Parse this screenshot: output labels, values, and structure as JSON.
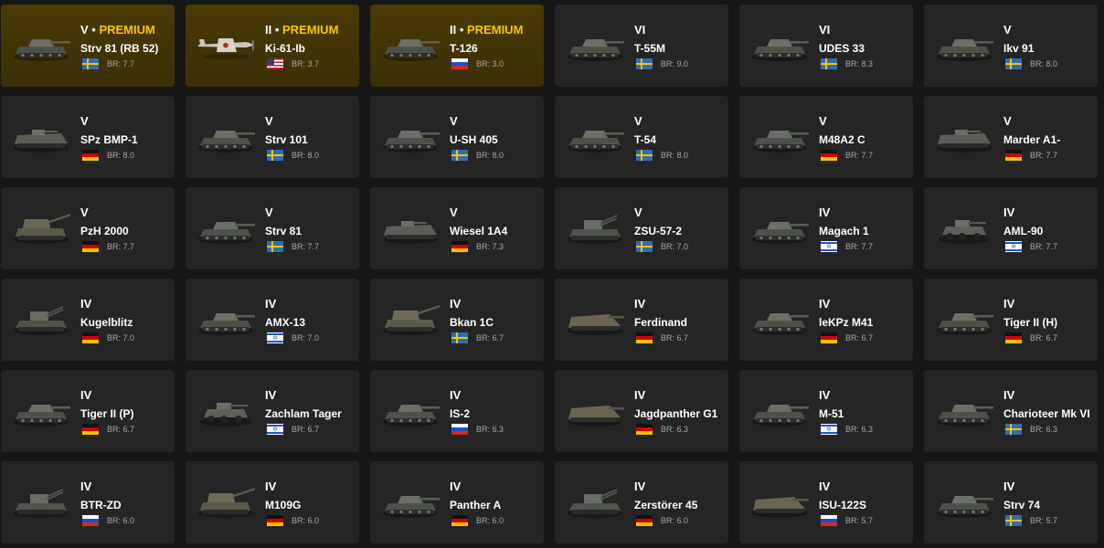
{
  "colors": {
    "background": "#161616",
    "card": "#252525",
    "premium_card": "#3b2f06",
    "premium_text": "#ffc400",
    "br_text": "#a9a9a9"
  },
  "vehicles": [
    {
      "rank": "V",
      "premium": "PREMIUM",
      "name": "Strv 81 (RB 52)",
      "flag": "sweden",
      "br": "BR: 7.7",
      "icon": "tank-icon"
    },
    {
      "rank": "II",
      "premium": "PREMIUM",
      "name": "Ki-61-Ib",
      "flag": "usa",
      "br": "BR: 3.7",
      "icon": "fighter-plane-icon"
    },
    {
      "rank": "II",
      "premium": "PREMIUM",
      "name": "T-126",
      "flag": "russia",
      "br": "BR: 3.0",
      "icon": "tank-icon"
    },
    {
      "rank": "VI",
      "premium": "",
      "name": "T-55M",
      "flag": "sweden",
      "br": "BR: 9.0",
      "icon": "tank-icon"
    },
    {
      "rank": "VI",
      "premium": "",
      "name": "UDES 33",
      "flag": "sweden",
      "br": "BR: 8.3",
      "icon": "tank-icon"
    },
    {
      "rank": "V",
      "premium": "",
      "name": "Ikv 91",
      "flag": "sweden",
      "br": "BR: 8.0",
      "icon": "tank-icon"
    },
    {
      "rank": "V",
      "premium": "",
      "name": "SPz BMP-1",
      "flag": "germany",
      "br": "BR: 8.0",
      "icon": "ifv-icon"
    },
    {
      "rank": "V",
      "premium": "",
      "name": "Strv 101",
      "flag": "sweden",
      "br": "BR: 8.0",
      "icon": "tank-icon"
    },
    {
      "rank": "V",
      "premium": "",
      "name": "U-SH 405",
      "flag": "sweden",
      "br": "BR: 8.0",
      "icon": "tank-icon"
    },
    {
      "rank": "V",
      "premium": "",
      "name": "T-54",
      "flag": "sweden",
      "br": "BR: 8.0",
      "icon": "tank-icon"
    },
    {
      "rank": "V",
      "premium": "",
      "name": "M48A2 C",
      "flag": "germany",
      "br": "BR: 7.7",
      "icon": "tank-icon"
    },
    {
      "rank": "V",
      "premium": "",
      "name": "Marder A1-",
      "flag": "germany",
      "br": "BR: 7.7",
      "icon": "ifv-icon"
    },
    {
      "rank": "V",
      "premium": "",
      "name": "PzH 2000",
      "flag": "germany",
      "br": "BR: 7.7",
      "icon": "spg-icon"
    },
    {
      "rank": "V",
      "premium": "",
      "name": "Strv 81",
      "flag": "sweden",
      "br": "BR: 7.7",
      "icon": "tank-icon"
    },
    {
      "rank": "V",
      "premium": "",
      "name": "Wiesel 1A4",
      "flag": "germany",
      "br": "BR: 7.3",
      "icon": "ifv-icon"
    },
    {
      "rank": "V",
      "premium": "",
      "name": "ZSU-57-2",
      "flag": "sweden",
      "br": "BR: 7.0",
      "icon": "spaa-icon"
    },
    {
      "rank": "IV",
      "premium": "",
      "name": "Magach 1",
      "flag": "israel",
      "br": "BR: 7.7",
      "icon": "tank-icon"
    },
    {
      "rank": "IV",
      "premium": "",
      "name": "AML-90",
      "flag": "israel",
      "br": "BR: 7.7",
      "icon": "armored-car-icon"
    },
    {
      "rank": "IV",
      "premium": "",
      "name": "Kugelblitz",
      "flag": "germany",
      "br": "BR: 7.0",
      "icon": "spaa-icon"
    },
    {
      "rank": "IV",
      "premium": "",
      "name": "AMX-13",
      "flag": "israel",
      "br": "BR: 7.0",
      "icon": "tank-icon"
    },
    {
      "rank": "IV",
      "premium": "",
      "name": "Bkan 1C",
      "flag": "sweden",
      "br": "BR: 6.7",
      "icon": "spg-icon"
    },
    {
      "rank": "IV",
      "premium": "",
      "name": "Ferdinand",
      "flag": "germany",
      "br": "BR: 6.7",
      "icon": "tank-destroyer-icon"
    },
    {
      "rank": "IV",
      "premium": "",
      "name": "leKPz M41",
      "flag": "germany",
      "br": "BR: 6.7",
      "icon": "tank-icon"
    },
    {
      "rank": "IV",
      "premium": "",
      "name": "Tiger II (H)",
      "flag": "germany",
      "br": "BR: 6.7",
      "icon": "tank-icon"
    },
    {
      "rank": "IV",
      "premium": "",
      "name": "Tiger II (P)",
      "flag": "germany",
      "br": "BR: 6.7",
      "icon": "tank-icon"
    },
    {
      "rank": "IV",
      "premium": "",
      "name": "Zachlam Tager",
      "flag": "israel",
      "br": "BR: 6.7",
      "icon": "armored-car-icon"
    },
    {
      "rank": "IV",
      "premium": "",
      "name": "IS-2",
      "flag": "russia",
      "br": "BR: 6.3",
      "icon": "tank-icon"
    },
    {
      "rank": "IV",
      "premium": "",
      "name": "Jagdpanther G1",
      "flag": "germany",
      "br": "BR: 6.3",
      "icon": "tank-destroyer-icon"
    },
    {
      "rank": "IV",
      "premium": "",
      "name": "M-51",
      "flag": "israel",
      "br": "BR: 6.3",
      "icon": "tank-icon"
    },
    {
      "rank": "IV",
      "premium": "",
      "name": "Charioteer Mk VI",
      "flag": "sweden",
      "br": "BR: 6.3",
      "icon": "tank-icon"
    },
    {
      "rank": "IV",
      "premium": "",
      "name": "BTR-ZD",
      "flag": "russia",
      "br": "BR: 6.0",
      "icon": "spaa-icon"
    },
    {
      "rank": "IV",
      "premium": "",
      "name": "M109G",
      "flag": "germany",
      "br": "BR: 6.0",
      "icon": "spg-icon"
    },
    {
      "rank": "IV",
      "premium": "",
      "name": "Panther A",
      "flag": "germany",
      "br": "BR: 6.0",
      "icon": "tank-icon"
    },
    {
      "rank": "IV",
      "premium": "",
      "name": "Zerstörer 45",
      "flag": "germany",
      "br": "BR: 6.0",
      "icon": "spaa-icon"
    },
    {
      "rank": "IV",
      "premium": "",
      "name": "ISU-122S",
      "flag": "russia",
      "br": "BR: 5.7",
      "icon": "tank-destroyer-icon"
    },
    {
      "rank": "IV",
      "premium": "",
      "name": "Strv 74",
      "flag": "sweden",
      "br": "BR: 5.7",
      "icon": "tank-icon"
    }
  ]
}
